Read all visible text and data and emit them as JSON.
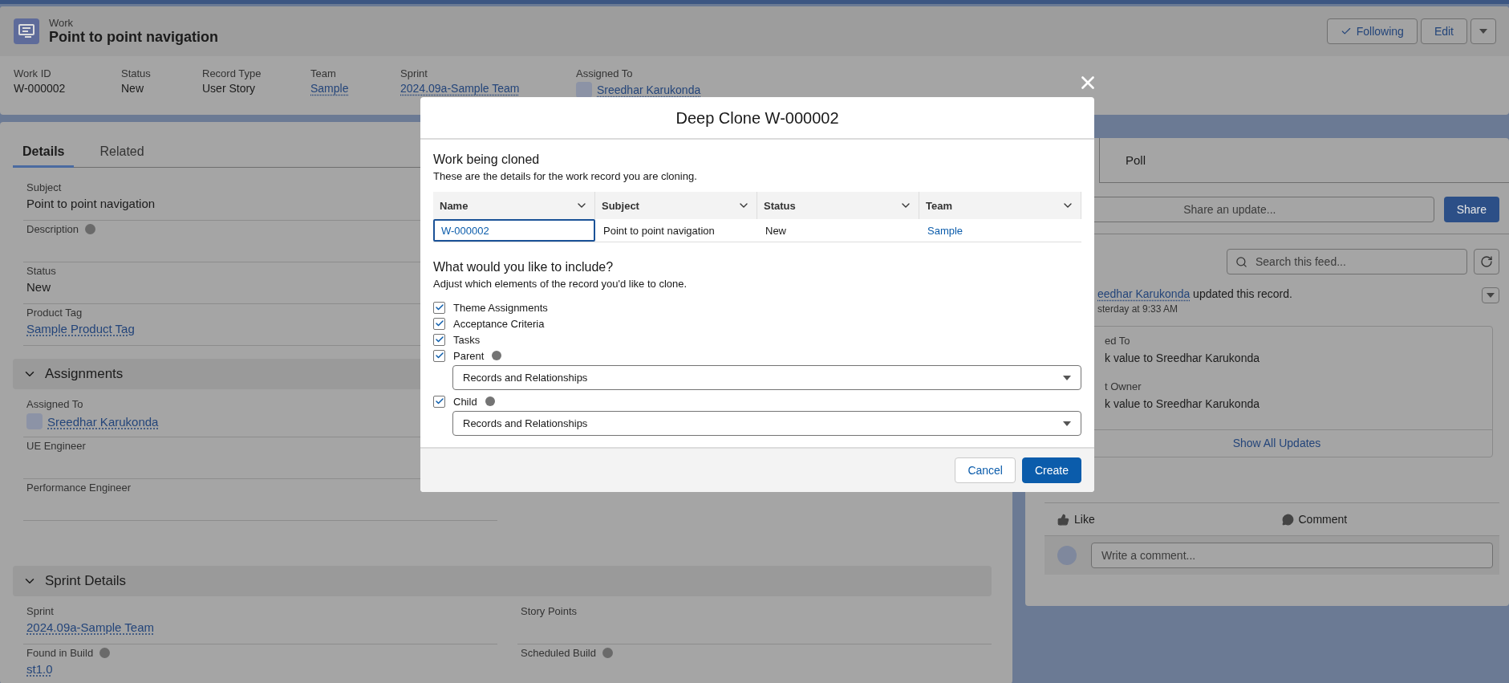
{
  "record": {
    "object_type": "Work",
    "title": "Point to point navigation",
    "actions": [
      {
        "label": "Following",
        "kind": "follow"
      },
      {
        "label": "Edit",
        "kind": "edit"
      },
      {
        "kind": "menu"
      }
    ]
  },
  "highlights": [
    {
      "label": "Work ID",
      "value": "W-000002",
      "kind": "text"
    },
    {
      "label": "Status",
      "value": "New",
      "kind": "text"
    },
    {
      "label": "Record Type",
      "value": "User Story",
      "kind": "text"
    },
    {
      "label": "Team",
      "value": "Sample",
      "kind": "link"
    },
    {
      "label": "Sprint",
      "value": "2024.09a-Sample Team",
      "kind": "link"
    },
    {
      "label": "Assigned To",
      "value": "Sreedhar Karukonda",
      "kind": "user"
    }
  ],
  "tabs": [
    {
      "label": "Details",
      "selected": true
    },
    {
      "label": "Related",
      "selected": false
    }
  ],
  "details": [
    {
      "rows": [
        [
          {
            "label": "Subject",
            "value": "Point to point navigation",
            "kind": "text",
            "info": false
          }
        ],
        [
          {
            "label": "Description",
            "kind": "text",
            "info": true
          }
        ],
        [
          {
            "label": "Status",
            "value": "New",
            "kind": "text",
            "info": false
          }
        ],
        [
          {
            "label": "Product Tag",
            "value": "Sample Product Tag",
            "kind": "link",
            "info": false
          }
        ]
      ]
    },
    {
      "title": "Assignments",
      "expanded": true,
      "rows": [
        [
          {
            "label": "Assigned To",
            "value": "Sreedhar Karukonda",
            "kind": "user",
            "info": false
          }
        ],
        [
          {
            "label": "UE Engineer",
            "kind": "text",
            "info": false
          }
        ],
        [
          {
            "label": "Performance Engineer",
            "kind": "text",
            "info": false
          }
        ]
      ]
    },
    {
      "title": "Sprint Details",
      "expanded": true,
      "rows": [
        [
          {
            "label": "Sprint",
            "value": "2024.09a-Sample Team",
            "kind": "link",
            "info": false
          },
          {
            "label": "Story Points",
            "kind": "text",
            "info": false
          }
        ],
        [
          {
            "label": "Found in Build",
            "value": "st1.0",
            "kind": "link",
            "info": true
          },
          {
            "label": "Scheduled Build",
            "kind": "text",
            "info": true
          }
        ]
      ]
    }
  ],
  "publisher": {
    "tab": "Poll",
    "placeholder": "Share an update...",
    "button": "Share"
  },
  "feed": {
    "search_placeholder": "Search this feed...",
    "item": {
      "author": "eedhar Karukonda",
      "action": "updated this record.",
      "time": "sterday at 9:33 AM",
      "changes": [
        {
          "field": "ed To",
          "text": "k value to Sreedhar Karukonda"
        },
        {
          "field": "t Owner",
          "text": "k value to Sreedhar Karukonda"
        }
      ],
      "show_all": "Show All Updates",
      "actions": [
        {
          "label": "Like",
          "kind": "like"
        },
        {
          "label": "Comment",
          "kind": "comment"
        }
      ],
      "comment_placeholder": "Write a comment..."
    }
  },
  "modal": {
    "title": "Deep Clone W-000002",
    "cloned": {
      "heading": "Work being cloned",
      "description": "These are the details for the work record you are cloning.",
      "columns": [
        "Name",
        "Subject",
        "Status",
        "Team"
      ],
      "rows": [
        [
          {
            "text": "W-000002",
            "kind": "link",
            "focused": true
          },
          {
            "text": "Point to point navigation",
            "kind": "text",
            "focused": false
          },
          {
            "text": "New",
            "kind": "text",
            "focused": false
          },
          {
            "text": "Sample",
            "kind": "link",
            "focused": false
          }
        ]
      ]
    },
    "include": {
      "heading": "What would you like to include?",
      "description": "Adjust which elements of the record you'd like to clone.",
      "options": [
        {
          "label": "Theme Assignments",
          "checked": true,
          "info": false
        },
        {
          "label": "Acceptance Criteria",
          "checked": true,
          "info": false
        },
        {
          "label": "Tasks",
          "checked": true,
          "info": false
        },
        {
          "label": "Parent",
          "checked": true,
          "info": true,
          "select": "Records and Relationships"
        },
        {
          "label": "Child",
          "checked": true,
          "info": true,
          "select": "Records and Relationships"
        }
      ]
    },
    "buttons": [
      {
        "label": "Cancel",
        "kind": "neutral"
      },
      {
        "label": "Create",
        "kind": "brand"
      }
    ]
  }
}
